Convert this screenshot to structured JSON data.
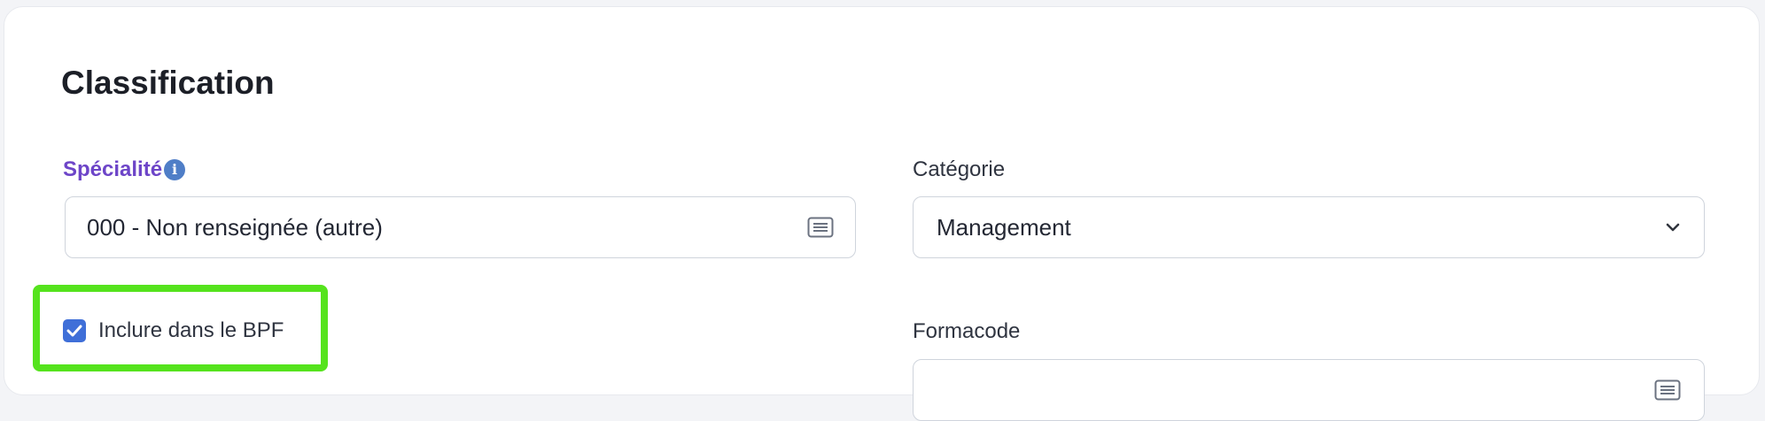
{
  "section": {
    "title": "Classification"
  },
  "specialite": {
    "label": "Spécialité",
    "value": "000 - Non renseignée (autre)",
    "info_icon": "info-icon",
    "picker_icon": "list-icon"
  },
  "categorie": {
    "label": "Catégorie",
    "value": "Management",
    "dropdown_icon": "chevron-down-icon"
  },
  "bpf": {
    "label": "Inclure dans le BPF",
    "checked": true,
    "highlight_color": "#55e31d"
  },
  "formacode": {
    "label": "Formacode",
    "value": ""
  },
  "colors": {
    "accent_label": "#6d45c8",
    "checkbox": "#3f6fd8",
    "highlight": "#55e31d"
  }
}
